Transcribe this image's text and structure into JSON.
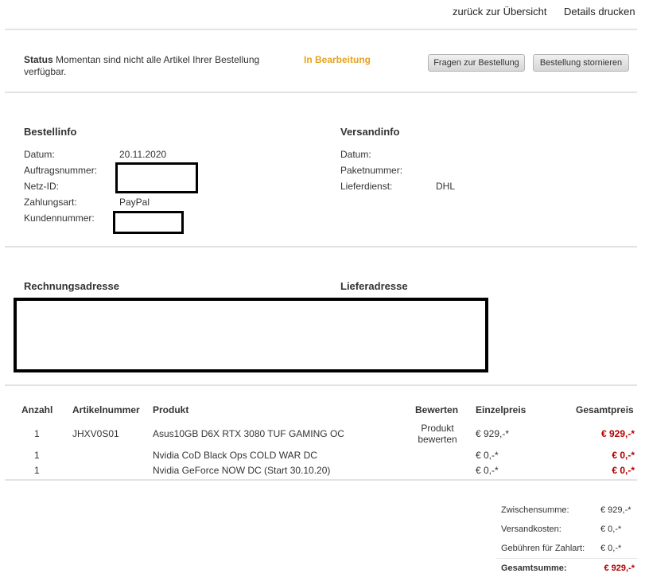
{
  "topbar": {
    "back_label": "zurück zur Übersicht",
    "print_label": "Details drucken"
  },
  "status": {
    "label": "Status",
    "message": "Momentan sind nicht alle Artikel Ihrer Bestellung verfügbar.",
    "badge": "In Bearbeitung",
    "badge_color": "#e8a31d",
    "question_button": "Fragen zur Bestellung",
    "cancel_button": "Bestellung stornieren"
  },
  "order_info": {
    "title": "Bestellinfo",
    "date_label": "Datum:",
    "date_value": "20.11.2020",
    "order_number_label": "Auftragsnummer:",
    "net_id_label": "Netz-ID:",
    "payment_label": "Zahlungsart:",
    "payment_value": "PayPal",
    "customer_number_label": "Kundennummer:"
  },
  "shipping_info": {
    "title": "Versandinfo",
    "date_label": "Datum:",
    "package_label": "Paketnummer:",
    "carrier_label": "Lieferdienst:",
    "carrier_value": "DHL"
  },
  "addresses": {
    "billing_title": "Rechnungsadresse",
    "delivery_title": "Lieferadresse"
  },
  "table": {
    "headers": {
      "qty": "Anzahl",
      "article_number": "Artikelnummer",
      "product": "Produkt",
      "rate": "Bewerten",
      "unit_price": "Einzelpreis",
      "total_price": "Gesamtpreis"
    },
    "rows": [
      {
        "qty": "1",
        "article_number": "JHXV0S01",
        "product": "Asus10GB D6X RTX 3080 TUF GAMING OC",
        "rate_line1": "Produkt",
        "rate_line2": "bewerten",
        "unit_price": "€ 929,-*",
        "total_price": "€ 929,-*"
      },
      {
        "qty": "1",
        "article_number": "",
        "product": "Nvidia CoD Black Ops COLD WAR DC",
        "rate_line1": "",
        "rate_line2": "",
        "unit_price": "€ 0,-*",
        "total_price": "€ 0,-*"
      },
      {
        "qty": "1",
        "article_number": "",
        "product": "Nvidia GeForce NOW DC (Start 30.10.20)",
        "rate_line1": "",
        "rate_line2": "",
        "unit_price": "€ 0,-*",
        "total_price": "€ 0,-*"
      }
    ],
    "price_color": "#b30000"
  },
  "summary": {
    "subtotal_label": "Zwischensumme:",
    "subtotal_value": "€ 929,-*",
    "shipping_label": "Versandkosten:",
    "shipping_value": "€ 0,-*",
    "fee_label": "Gebühren für Zahlart:",
    "fee_value": "€ 0,-*",
    "total_label": "Gesamtsumme:",
    "total_value": "€ 929,-*"
  }
}
